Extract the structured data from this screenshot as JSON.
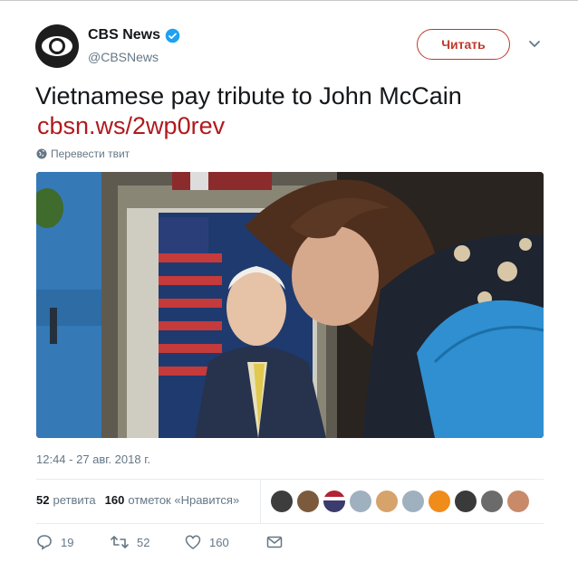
{
  "tweet": {
    "author_name": "CBS News",
    "author_handle": "@CBSNews",
    "follow_label": "Читать",
    "text": "Vietnamese pay tribute to John McCain",
    "link": "cbsn.ws/2wp0rev",
    "translate_label": "Перевести твит",
    "timestamp": "12:44 - 27 авг. 2018 г."
  },
  "stats": {
    "retweets_count": "52",
    "retweets_label": "ретвита",
    "likes_count": "160",
    "likes_label": "отметок «Нравится»",
    "liker_count": 10
  },
  "actions": {
    "reply_count": "19",
    "retweet_count": "52",
    "like_count": "160"
  },
  "icons": {
    "verified": "verified-badge-icon",
    "caret": "chevron-down-icon",
    "globe": "globe-icon",
    "reply": "reply-icon",
    "retweet": "retweet-icon",
    "like": "heart-icon",
    "message": "envelope-icon"
  },
  "colors": {
    "accent": "#b01a1e",
    "verified": "#1da1f2",
    "muted": "#657786"
  }
}
